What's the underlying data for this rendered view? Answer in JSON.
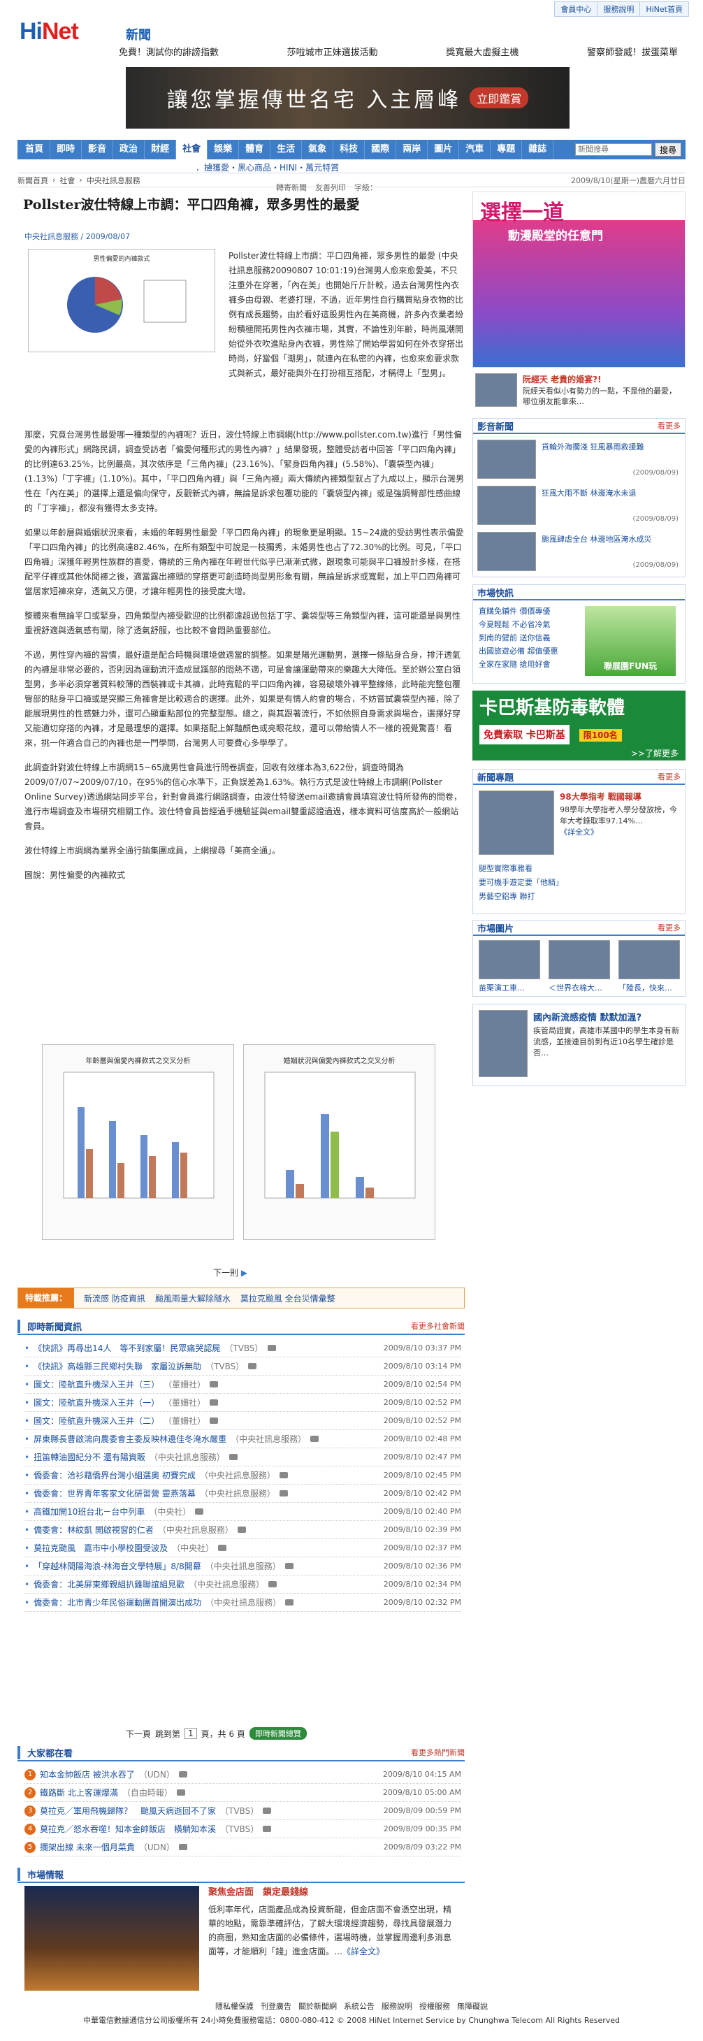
{
  "top_links": [
    "會員中心",
    "服務說明",
    "HiNet首頁"
  ],
  "logo": {
    "brand_a": "Hi",
    "brand_b": "Net",
    "sub": "新聞"
  },
  "headlines": [
    "免費！測試你的誹謗指數",
    "莎啦城市正妹選拔活動",
    "獎寬最大虛擬主機",
    "警察師發威！拔蛋菜單"
  ],
  "banner": {
    "text": "讓您掌握傳世名宅 入主層峰",
    "cta": "立即鑑賞"
  },
  "nav": {
    "items": [
      "首頁",
      "即時",
      "影音",
      "政治",
      "財經",
      "社會",
      "娛樂",
      "體育",
      "生活",
      "氣象",
      "科技",
      "國際",
      "兩岸",
      "圖片",
      "汽車",
      "專題",
      "雜誌"
    ],
    "active": 5,
    "search_placeholder": "新聞搜尋",
    "search_button": "搜尋"
  },
  "subnav": {
    "links": "．擄獲愛・黑心商品・HINI・萬元特賞"
  },
  "crumbs": {
    "items": [
      "新聞首頁",
      "社會",
      "中央社訊息服務"
    ],
    "date": "2009/8/10(星期一)農曆六月廿日"
  },
  "tools": [
    "轉寄新聞",
    "友善列印",
    "字級："
  ],
  "article": {
    "title": "Pollster波仕特線上市調：平口四角褲，眾多男性的最愛",
    "source": "中央社訊息服務 / 2009/08/07",
    "figure_title": "男性偏愛的內褲款式",
    "p1": "Pollster波仕特線上市調：平口四角褲，眾多男性的最愛 (中央社訊息服務20090807 10:01:19)台灣男人愈來愈愛美，不只注重外在穿著，「內在美」也開始斤斤計較，過去台灣男性內衣褲多由母親、老婆打理，不過，近年男性自行購買貼身衣物的比例有成長趨勢，由於看好這股男性內在美商機，許多內衣業者紛紛積極開拓男性內衣褲市場，其實，不論性別年齡，時尚風潮開始從外衣吹進貼身內衣褲，男性除了開始學習如何在外衣穿搭出時尚，好當個「潮男」，就連內在私密的內褲，也愈來愈要求款式與新式，最好能與外在打扮相互搭配，才稱得上「型男」。",
    "p2": "那麼，究竟台灣男性最愛哪一種類型的內褲呢？近日，波仕特線上市調網(http://www.pollster.com.tw)進行「男性偏愛的內褲形式」網路民調，調查受訪者「偏愛何種形式的男性內褲？」結果發現，整體受訪者中回答「平口四角內褲」的比例達63.25%，比例最高，其次依序是「三角內褲」(23.16%)、「緊身四角內褲」(5.58%)、「囊袋型內褲」(1.13%)「丁字褲」(1.10%)。其中，「平口四角內褲」與「三角內褲」兩大傳統內褲類型就占了九成以上，顯示台灣男性在「內在美」的選擇上還是偏向保守，反觀新式內褲，無論是訴求包覆功能的「囊袋型內褲」或是強調臀部性感曲線的「丁字褲」，都沒有獲得太多支持。",
    "p3": "如果以年齡層與婚姻狀況來看，未婚的年輕男性最愛「平口四角內褲」的現象更是明顯。15~24歲的受訪男性表示偏愛「平口四角內褲」的比例高達82.46%，在所有類型中可說是一枝獨秀，未婚男性也占了72.30%的比例。可見，「平口四角褲」深獲年輕男性族群的喜愛，傳統的三角內褲在年輕世代似乎已漸漸式微，跟現象可能與平口褲設計多樣，在搭配平仔褲或其他休閒褲之後，適當露出褲頭的穿搭更可創造時尚型男形象有關，無論是訴求或寬鬆，加上平口四角褲可當居家短褲來穿，透氣又方便，才讓年輕男性的接受度大增。",
    "p4": "整體來看無論平口或緊身，四角類型內褲受歡迎的比例都遠超過包括丁字、囊袋型等三角類型內褲，這可能還是與男性重視舒適與透氣感有關，除了透氣舒服，也比較不會悶熱重要部位。",
    "p5": "不過，男性穿內褲的習慣，最好還是配合時機與環境做適當的調整。如果是陽光運動男，選擇一條貼身合身，排汗透氣的內褲是非常必要的，否則因為運動流汗造成鼠蹊部的悶熱不適，可是會讓運動帶來的樂趣大大降低。至於辦公室白領型男，多半必須穿著質料較薄的西裝褲或卡其褲，此時寬鬆的平口四角內褲，容易破壞外褲平整線條，此時能完整包覆臀部的貼身平口褲或是突顯三角褲會是比較適合的選擇。此外，如果是有情人約會的場合，不妨嘗試囊袋型內褲，除了能展現男性的性感魅力外，還可凸顯重點部位的完整型態。總之，與其跟著流行，不如依照自身需求與場合，選擇好穿又能適切穿搭的內褲，才是最理想的選擇。如果搭配上鮮豔顏色或亮眼花紋，還可以帶給情人不一樣的視覺驚喜！看來，挑一件適合自己的內褲也是一門學問，台灣男人可要費心多學學了。",
    "p6": "此調查針對波仕特線上市調網15~65歲男性會員進行問卷調查，回收有效樣本為3,622份，調查時間為2009/07/07~2009/07/10，在95%的信心水準下，正負誤差為1.63%。執行方式是波仕特線上市調網(Pollster Online Survey)透過網站同步平台，針對會員進行網路調查，由波仕特發送email邀請會員填寫波仕特所發佈的問卷，進行市場調查及市場研究相關工作。波仕特會員皆經過手機驗証與email雙重認證過過，樣本資料可信度高於一般網站會員。",
    "p7": "波仕特線上市調網為業界全通行銷集團成員，上網搜尋「美商全通」。",
    "p8": "圖說：男性偏愛的內褲款式",
    "chart1_title": "年齡層與偏愛內褲款式之交叉分析",
    "chart2_title": "婚姻狀況與偏愛內褲款式之交叉分析",
    "next_label": "下一則"
  },
  "special": {
    "label": "特載推薦：",
    "items": [
      "新流感 防疫資訊",
      "颱風雨量大解除隧水",
      "莫拉克颱風 全台災情彙整"
    ]
  },
  "instant": {
    "title": "即時新聞資訊",
    "more": "看更多社會新聞",
    "rows": [
      {
        "t": "《快訊》再尋出14人　等不到家屬！民眾痛哭認屍",
        "s": "（TVBS）",
        "time": "2009/8/10 03:37 PM"
      },
      {
        "t": "《快訊》高雄縣三民鄉村失聯　家屬泣訴無助",
        "s": "（TVBS）",
        "time": "2009/8/10 03:14 PM"
      },
      {
        "t": "圖文：陸航直升機深入王井（三）",
        "s": "（董姍社）",
        "time": "2009/8/10 02:54 PM"
      },
      {
        "t": "圖文：陸航直升機深入王井（一）",
        "s": "（董姍社）",
        "time": "2009/8/10 02:52 PM"
      },
      {
        "t": "圖文：陸航直升機深入王井（二）",
        "s": "（董姍社）",
        "time": "2009/8/10 02:52 PM"
      },
      {
        "t": "屏東縣長曹啟鴻向農委會主委反映林邊佳冬淹水嚴重",
        "s": "（中央社訊息服務）",
        "time": "2009/8/10 02:48 PM"
      },
      {
        "t": "扭笛轉油國紀分不 還有陽資販",
        "s": "（中央社訊息服務）",
        "time": "2009/8/10 02:47 PM"
      },
      {
        "t": "僑委會：洽衫藉僑界台灣小組選奧 初賽究成",
        "s": "（中央社訊息服務）",
        "time": "2009/8/10 02:45 PM"
      },
      {
        "t": "僑委會：世界青年客家文化研習營 靈燕落幕",
        "s": "（中央社訊息服務）",
        "time": "2009/8/10 02:42 PM"
      },
      {
        "t": "高鐵加開10班台北－台中列車",
        "s": "（中央社）",
        "time": "2009/8/10 02:40 PM"
      },
      {
        "t": "僑委會：林紋凱 開啟視窗的仁者",
        "s": "（中央社訊息服務）",
        "time": "2009/8/10 02:39 PM"
      },
      {
        "t": "莫拉克颱風　嘉市中小學校園受波及",
        "s": "（中央社）",
        "time": "2009/8/10 02:37 PM"
      },
      {
        "t": "「穿越林間陽海浪-林海音文學特展」8/8開幕",
        "s": "（中央社訊息服務）",
        "time": "2009/8/10 02:36 PM"
      },
      {
        "t": "僑委會：北美屏東鄉親組扒雞聯誼組見歡",
        "s": "（中央社訊息服務）",
        "time": "2009/8/10 02:34 PM"
      },
      {
        "t": "僑委會：北市青少年民俗運動團首開演出成功",
        "s": "（中央社訊息服務）",
        "time": "2009/8/10 02:32 PM"
      }
    ],
    "pager": {
      "prev": "下一頁",
      "jump": "跳到第",
      "page": "1",
      "total": "頁，共 6 頁",
      "btn": "即時新聞總覽"
    }
  },
  "popular": {
    "title": "大家都在看",
    "more": "看更多熱門新聞",
    "rows": [
      {
        "n": "1",
        "t": "知本金帥飯店 被洪水吞了",
        "s": "（UDN）",
        "time": "2009/8/10 04:15 AM"
      },
      {
        "n": "2",
        "t": "鐵路斷 北上客運爆滿",
        "s": "（自由時報）",
        "time": "2009/8/10 05:00 AM"
      },
      {
        "n": "3",
        "t": "莫拉克／軍用飛機歸隊？　颱風天病逝回不了家",
        "s": "（TVBS）",
        "time": "2009/8/09 00:59 PM"
      },
      {
        "n": "4",
        "t": "莫拉克／怒水吞噬！知本金帥飯店　橫躺知本溪",
        "s": "（TVBS）",
        "time": "2009/8/09 00:35 PM"
      },
      {
        "n": "5",
        "t": "攔架出線 未來一個月菜貴",
        "s": "（UDN）",
        "time": "2009/8/09 03:22 PM"
      }
    ]
  },
  "market": {
    "title": "市場情報",
    "headline": "聚焦金店面　鎖定最錢線",
    "body": "低利率年代，店面產品成為投資新龍，但金店面不會憑空出現，精華的地點，需靠準確評估，了解大環境經濟趨勢，尋找具發展潛力的商圈，熟知金店面的必備條件，選場時機，並掌握周邊利多消息面等，才能順利「錢」進金店面。…",
    "more": "《詳全文》"
  },
  "footer": {
    "links": [
      "隱私權保護",
      "刊登廣告",
      "關於新聞網",
      "系統公告",
      "服務說明",
      "授權服務",
      "無障礙說"
    ],
    "copy": "中華電信數據通信分公司版權所有 24小時免費服務電話：0800-080-412 © 2008 HiNet Internet Service by Chunghwa Telecom All Rights Reserved"
  },
  "sidebar": {
    "ad1_big": "選擇一道",
    "ad1_sub": "動漫殿堂的任意門",
    "hot": {
      "title": "阮經天 老貴的婚宴?!",
      "desc": "阮經天看似小有勢力的一點，不是他的最愛，哪位朋友能拿來…"
    },
    "video": {
      "title": "影音新聞",
      "more": "看更多",
      "rows": [
        {
          "t": "貨輪外海擱淺 狂風暴雨救援難",
          "time": "(2009/08/09)"
        },
        {
          "t": "狂風大雨不斷 林邊淹水未退",
          "time": "(2009/08/09)"
        },
        {
          "t": "颱風肆虐全台 林邊地區淹水成災",
          "time": "(2009/08/09)"
        }
      ]
    },
    "mkt": {
      "title": "市場快訊",
      "items": [
        "直購免鋪件 價價專優",
        "今夏輕鬆 不必省冷氣",
        "到南的健前 送你信義",
        "出國旅遊必備 超值優惠",
        "全家在家隨 搶用好會"
      ],
      "badge": "聯展園FUN玩"
    },
    "ad2": {
      "h": "卡巴斯基防毒軟體",
      "s": "免費索取 卡巴斯基",
      "n": "限100名",
      "btn": ">>了解更多"
    },
    "topic": {
      "title": "新聞專題",
      "more": "看更多",
      "headline": "98大學指考 戰國報導",
      "desc": "98學年大學指考入學分發放榜，今年大考錄取率97.14%…",
      "link": "《詳全文》",
      "items": [
        "腿型實際事雅看",
        "要可機手遊定要「他騎」",
        "男藝空鋁專 聯打"
      ]
    },
    "photos": {
      "title": "市場圖片",
      "more": "看更多",
      "caps": [
        "苗栗演工車…",
        "＜世界衣棉大…",
        "「陸長，快來…"
      ]
    },
    "ad3": {
      "title": "國內新流感疫情 默默加溫?",
      "desc": "疾管局證實，高雄市某國中的學生本身有新流感，並接連目前到有近10名學生確診是否…"
    }
  }
}
